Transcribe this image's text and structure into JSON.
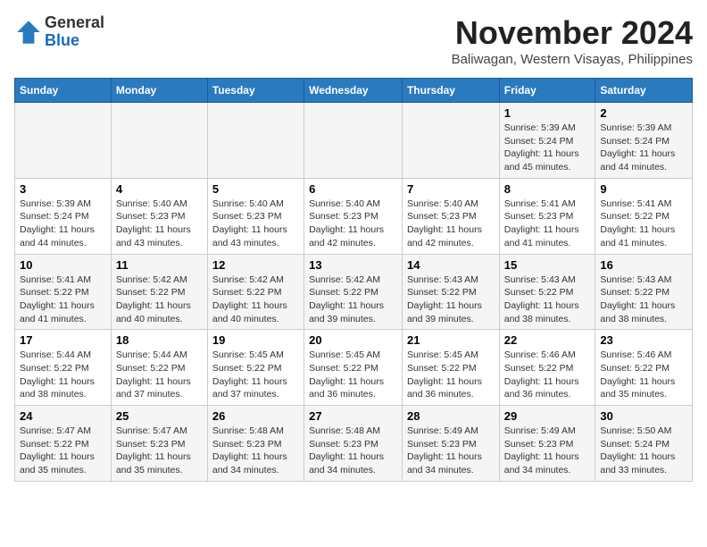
{
  "header": {
    "logo_general": "General",
    "logo_blue": "Blue",
    "month_title": "November 2024",
    "subtitle": "Baliwagan, Western Visayas, Philippines"
  },
  "weekdays": [
    "Sunday",
    "Monday",
    "Tuesday",
    "Wednesday",
    "Thursday",
    "Friday",
    "Saturday"
  ],
  "weeks": [
    [
      {
        "day": "",
        "info": ""
      },
      {
        "day": "",
        "info": ""
      },
      {
        "day": "",
        "info": ""
      },
      {
        "day": "",
        "info": ""
      },
      {
        "day": "",
        "info": ""
      },
      {
        "day": "1",
        "info": "Sunrise: 5:39 AM\nSunset: 5:24 PM\nDaylight: 11 hours and 45 minutes."
      },
      {
        "day": "2",
        "info": "Sunrise: 5:39 AM\nSunset: 5:24 PM\nDaylight: 11 hours and 44 minutes."
      }
    ],
    [
      {
        "day": "3",
        "info": "Sunrise: 5:39 AM\nSunset: 5:24 PM\nDaylight: 11 hours and 44 minutes."
      },
      {
        "day": "4",
        "info": "Sunrise: 5:40 AM\nSunset: 5:23 PM\nDaylight: 11 hours and 43 minutes."
      },
      {
        "day": "5",
        "info": "Sunrise: 5:40 AM\nSunset: 5:23 PM\nDaylight: 11 hours and 43 minutes."
      },
      {
        "day": "6",
        "info": "Sunrise: 5:40 AM\nSunset: 5:23 PM\nDaylight: 11 hours and 42 minutes."
      },
      {
        "day": "7",
        "info": "Sunrise: 5:40 AM\nSunset: 5:23 PM\nDaylight: 11 hours and 42 minutes."
      },
      {
        "day": "8",
        "info": "Sunrise: 5:41 AM\nSunset: 5:23 PM\nDaylight: 11 hours and 41 minutes."
      },
      {
        "day": "9",
        "info": "Sunrise: 5:41 AM\nSunset: 5:22 PM\nDaylight: 11 hours and 41 minutes."
      }
    ],
    [
      {
        "day": "10",
        "info": "Sunrise: 5:41 AM\nSunset: 5:22 PM\nDaylight: 11 hours and 41 minutes."
      },
      {
        "day": "11",
        "info": "Sunrise: 5:42 AM\nSunset: 5:22 PM\nDaylight: 11 hours and 40 minutes."
      },
      {
        "day": "12",
        "info": "Sunrise: 5:42 AM\nSunset: 5:22 PM\nDaylight: 11 hours and 40 minutes."
      },
      {
        "day": "13",
        "info": "Sunrise: 5:42 AM\nSunset: 5:22 PM\nDaylight: 11 hours and 39 minutes."
      },
      {
        "day": "14",
        "info": "Sunrise: 5:43 AM\nSunset: 5:22 PM\nDaylight: 11 hours and 39 minutes."
      },
      {
        "day": "15",
        "info": "Sunrise: 5:43 AM\nSunset: 5:22 PM\nDaylight: 11 hours and 38 minutes."
      },
      {
        "day": "16",
        "info": "Sunrise: 5:43 AM\nSunset: 5:22 PM\nDaylight: 11 hours and 38 minutes."
      }
    ],
    [
      {
        "day": "17",
        "info": "Sunrise: 5:44 AM\nSunset: 5:22 PM\nDaylight: 11 hours and 38 minutes."
      },
      {
        "day": "18",
        "info": "Sunrise: 5:44 AM\nSunset: 5:22 PM\nDaylight: 11 hours and 37 minutes."
      },
      {
        "day": "19",
        "info": "Sunrise: 5:45 AM\nSunset: 5:22 PM\nDaylight: 11 hours and 37 minutes."
      },
      {
        "day": "20",
        "info": "Sunrise: 5:45 AM\nSunset: 5:22 PM\nDaylight: 11 hours and 36 minutes."
      },
      {
        "day": "21",
        "info": "Sunrise: 5:45 AM\nSunset: 5:22 PM\nDaylight: 11 hours and 36 minutes."
      },
      {
        "day": "22",
        "info": "Sunrise: 5:46 AM\nSunset: 5:22 PM\nDaylight: 11 hours and 36 minutes."
      },
      {
        "day": "23",
        "info": "Sunrise: 5:46 AM\nSunset: 5:22 PM\nDaylight: 11 hours and 35 minutes."
      }
    ],
    [
      {
        "day": "24",
        "info": "Sunrise: 5:47 AM\nSunset: 5:22 PM\nDaylight: 11 hours and 35 minutes."
      },
      {
        "day": "25",
        "info": "Sunrise: 5:47 AM\nSunset: 5:23 PM\nDaylight: 11 hours and 35 minutes."
      },
      {
        "day": "26",
        "info": "Sunrise: 5:48 AM\nSunset: 5:23 PM\nDaylight: 11 hours and 34 minutes."
      },
      {
        "day": "27",
        "info": "Sunrise: 5:48 AM\nSunset: 5:23 PM\nDaylight: 11 hours and 34 minutes."
      },
      {
        "day": "28",
        "info": "Sunrise: 5:49 AM\nSunset: 5:23 PM\nDaylight: 11 hours and 34 minutes."
      },
      {
        "day": "29",
        "info": "Sunrise: 5:49 AM\nSunset: 5:23 PM\nDaylight: 11 hours and 34 minutes."
      },
      {
        "day": "30",
        "info": "Sunrise: 5:50 AM\nSunset: 5:24 PM\nDaylight: 11 hours and 33 minutes."
      }
    ]
  ]
}
